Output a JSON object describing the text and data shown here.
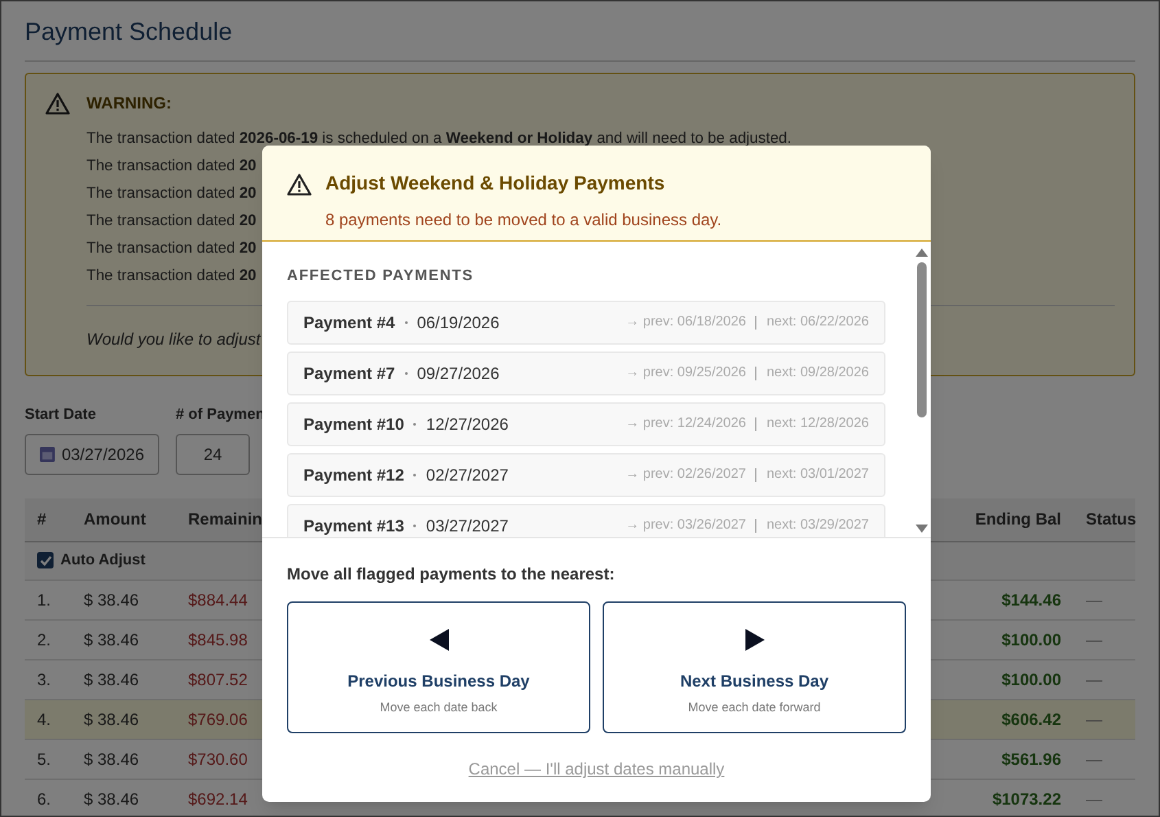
{
  "page": {
    "title": "Payment Schedule"
  },
  "warning": {
    "title": "WARNING:",
    "lines": [
      "The transaction dated **2026-06-19** is scheduled on a **Weekend or Holiday** and will need to be adjusted.",
      "The transaction dated **20**",
      "The transaction dated **20**",
      "The transaction dated **20**",
      "The transaction dated **20**",
      "The transaction dated **20**"
    ],
    "question": "Would you like to adjust"
  },
  "form": {
    "fields": [
      {
        "label": "Start Date",
        "value": "03/27/2026",
        "kind": "date"
      },
      {
        "label": "# of Paymen",
        "value": "24",
        "kind": "number"
      }
    ]
  },
  "table": {
    "columns": [
      "#",
      "Amount",
      "Remainin",
      "Ending Bal",
      "Status"
    ],
    "auto_adjust": {
      "label": "Auto Adjust",
      "checked": true
    },
    "rows": [
      {
        "cells": [
          "1.",
          "$ 38.46",
          "$884.44",
          "$144.46",
          "—"
        ],
        "flagged": false
      },
      {
        "cells": [
          "2.",
          "$ 38.46",
          "$845.98",
          "$100.00",
          "—"
        ],
        "flagged": false
      },
      {
        "cells": [
          "3.",
          "$ 38.46",
          "$807.52",
          "$100.00",
          "—"
        ],
        "flagged": false
      },
      {
        "cells": [
          "4.",
          "$ 38.46",
          "$769.06",
          "$606.42",
          "—"
        ],
        "flagged": true
      },
      {
        "cells": [
          "5.",
          "$ 38.46",
          "$730.60",
          "$561.96",
          "—"
        ],
        "flagged": false
      },
      {
        "cells": [
          "6.",
          "$ 38.46",
          "$692.14",
          "$1073.22",
          "—"
        ],
        "flagged": false
      }
    ]
  },
  "dialog": {
    "title": "Adjust Weekend & Holiday Payments",
    "subtitle": "8 payments need to be moved to a valid business day.",
    "section": "AFFECTED PAYMENTS",
    "payments": [
      {
        "name": "Payment #4",
        "date": "06/19/2026",
        "prev": "→ prev: 06/18/2026",
        "next": "next: 06/22/2026"
      },
      {
        "name": "Payment #7",
        "date": "09/27/2026",
        "prev": "→ prev: 09/25/2026",
        "next": "next: 09/28/2026"
      },
      {
        "name": "Payment #10",
        "date": "12/27/2026",
        "prev": "→ prev: 12/24/2026",
        "next": "next: 12/28/2026"
      },
      {
        "name": "Payment #12",
        "date": "02/27/2027",
        "prev": "→ prev: 02/26/2027",
        "next": "next: 03/01/2027"
      },
      {
        "name": "Payment #13",
        "date": "03/27/2027",
        "prev": "→ prev: 03/26/2027",
        "next": "next: 03/29/2027"
      }
    ],
    "prompt": "Move all flagged payments to the nearest:",
    "options": [
      {
        "kind": "back",
        "title": "Previous Business Day",
        "hint": "Move each date back"
      },
      {
        "kind": "forward",
        "title": "Next Business Day",
        "hint": "Move each date forward"
      }
    ],
    "cancel": "Cancel — I'll adjust dates manually"
  }
}
